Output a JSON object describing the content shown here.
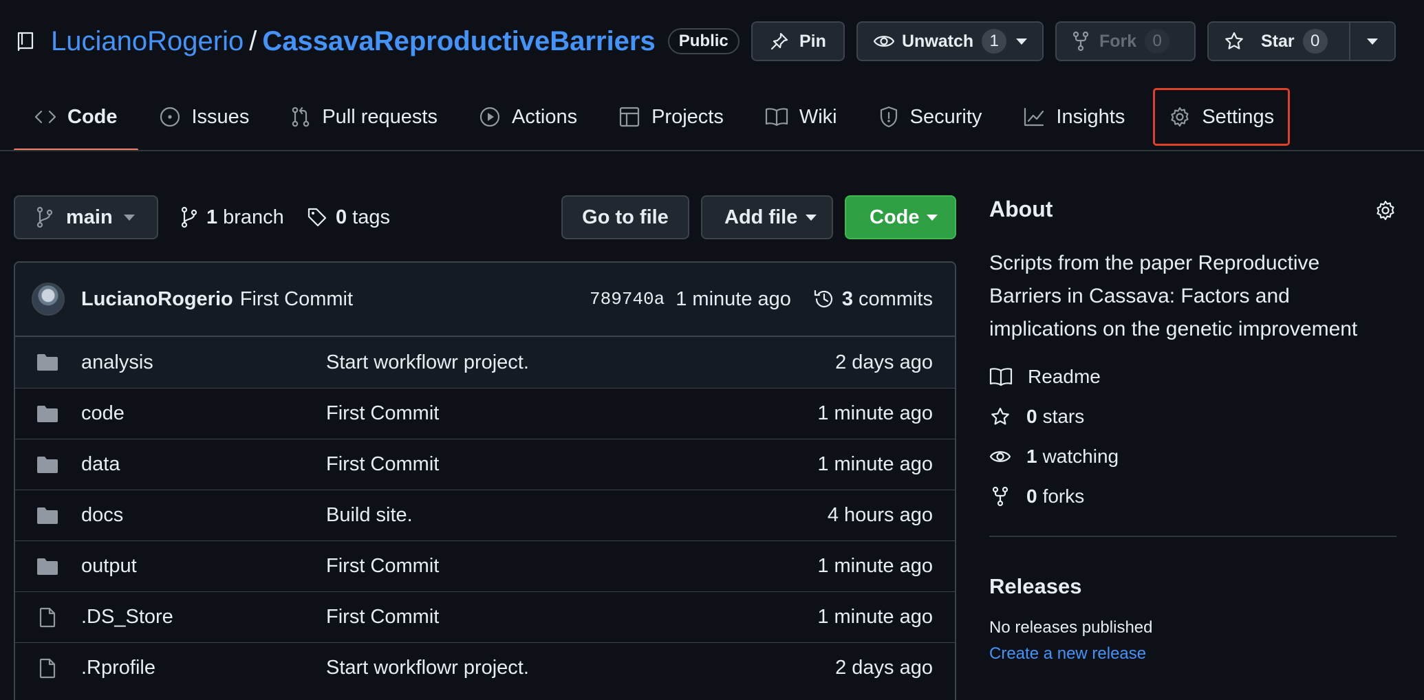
{
  "repo": {
    "owner": "LucianoRogerio",
    "separator": "/",
    "name": "CassavaReproductiveBarriers",
    "visibility": "Public"
  },
  "header_actions": {
    "pin_label": "Pin",
    "unwatch_label": "Unwatch",
    "unwatch_count": "1",
    "fork_label": "Fork",
    "fork_count": "0",
    "star_label": "Star",
    "star_count": "0"
  },
  "tabs": [
    {
      "label": "Code",
      "icon": "code-icon"
    },
    {
      "label": "Issues",
      "icon": "issue-icon"
    },
    {
      "label": "Pull requests",
      "icon": "pull-request-icon"
    },
    {
      "label": "Actions",
      "icon": "play-icon"
    },
    {
      "label": "Projects",
      "icon": "table-icon"
    },
    {
      "label": "Wiki",
      "icon": "book-icon"
    },
    {
      "label": "Security",
      "icon": "shield-icon"
    },
    {
      "label": "Insights",
      "icon": "graph-icon"
    },
    {
      "label": "Settings",
      "icon": "gear-icon"
    }
  ],
  "toolbar": {
    "branch": "main",
    "branch_count": "1",
    "branch_label": "branch",
    "tag_count": "0",
    "tag_label": "tags",
    "go_to_file": "Go to file",
    "add_file": "Add file",
    "code": "Code"
  },
  "latest_commit": {
    "author": "LucianoRogerio",
    "message": "First Commit",
    "sha": "789740a",
    "time": "1 minute ago",
    "commit_count": "3",
    "commit_label": "commits"
  },
  "files": [
    {
      "type": "folder",
      "name": "analysis",
      "message": "Start workflowr project.",
      "date": "2 days ago"
    },
    {
      "type": "folder",
      "name": "code",
      "message": "First Commit",
      "date": "1 minute ago"
    },
    {
      "type": "folder",
      "name": "data",
      "message": "First Commit",
      "date": "1 minute ago"
    },
    {
      "type": "folder",
      "name": "docs",
      "message": "Build site.",
      "date": "4 hours ago"
    },
    {
      "type": "folder",
      "name": "output",
      "message": "First Commit",
      "date": "1 minute ago"
    },
    {
      "type": "file",
      "name": ".DS_Store",
      "message": "First Commit",
      "date": "1 minute ago"
    },
    {
      "type": "file",
      "name": ".Rprofile",
      "message": "Start workflowr project.",
      "date": "2 days ago"
    }
  ],
  "about": {
    "title": "About",
    "description": "Scripts from the paper Reproductive Barriers in Cassava: Factors and implications on the genetic improvement",
    "readme": "Readme",
    "stars_count": "0",
    "stars_label": "stars",
    "watching_count": "1",
    "watching_label": "watching",
    "forks_count": "0",
    "forks_label": "forks"
  },
  "releases": {
    "title": "Releases",
    "none_text": "No releases published",
    "create_link": "Create a new release"
  },
  "colors": {
    "background": "#0d1117",
    "link": "#4493f8",
    "code_button": "#2ea043",
    "active_tab_underline": "#f78166",
    "highlight_box": "#e0402a"
  }
}
